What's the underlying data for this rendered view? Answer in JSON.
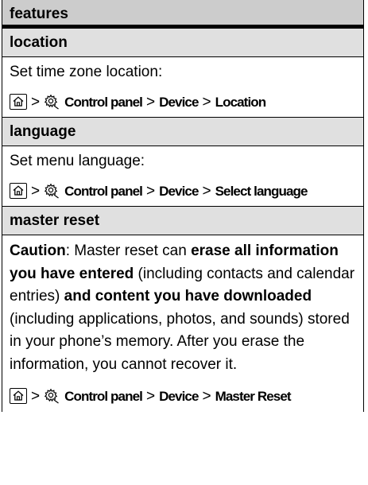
{
  "header": {
    "title": "features"
  },
  "sections": [
    {
      "title": "location",
      "description": "Set time zone location:",
      "path": {
        "step1": "Control panel",
        "step2": "Device",
        "step3": "Location"
      }
    },
    {
      "title": "language",
      "description": "Set menu language:",
      "path": {
        "step1": "Control panel",
        "step2": "Device",
        "step3": "Select language"
      }
    },
    {
      "title": "master reset",
      "caution": {
        "label": "Caution",
        "t1": ": Master reset can ",
        "b1": "erase all information you have entered",
        "t2": " (including contacts and calendar entries) ",
        "b2": "and content you have downloaded",
        "t3": " (including applications, photos, and sounds) stored in your phone’s memory. After you erase the information, you cannot recover it."
      },
      "path": {
        "step1": "Control panel",
        "step2": "Device",
        "step3": "Master Reset"
      }
    }
  ],
  "separator": ">",
  "icons": {
    "home": "home-key-icon",
    "settings": "settings-gear-icon"
  }
}
